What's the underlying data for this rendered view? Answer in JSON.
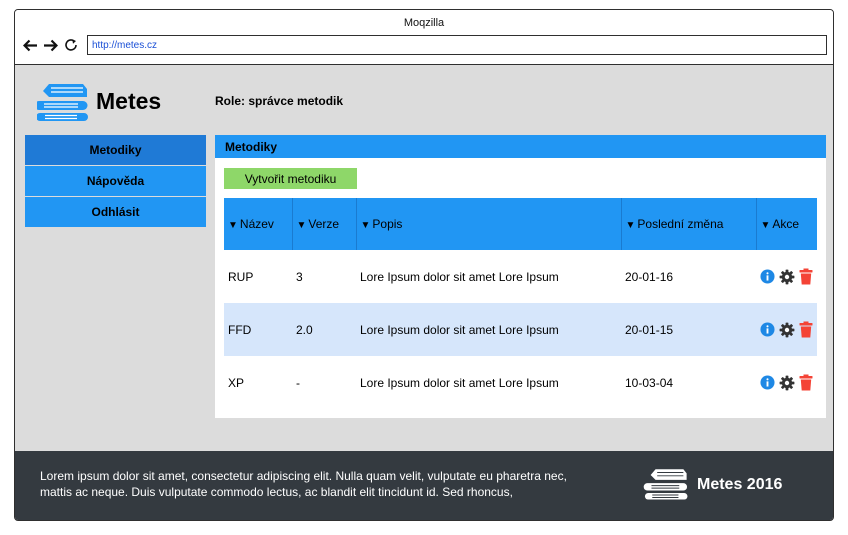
{
  "browser": {
    "title": "Moqzilla",
    "url": "http://metes.cz"
  },
  "app": {
    "name": "Metes",
    "role": "Role: správce metodik"
  },
  "sidebar": {
    "items": [
      {
        "label": "Metodiky"
      },
      {
        "label": "Nápověda"
      },
      {
        "label": "Odhlásit"
      }
    ]
  },
  "panel": {
    "title": "Metodiky",
    "create_label": "Vytvořit metodiku"
  },
  "table": {
    "columns": [
      "Název",
      "Verze",
      "Popis",
      "Poslední změna",
      "Akce"
    ],
    "rows": [
      {
        "name": "RUP",
        "version": "3",
        "description": "Lore Ipsum dolor sit amet Lore Ipsum",
        "changed": "20-01-16"
      },
      {
        "name": "FFD",
        "version": "2.0",
        "description": "Lore Ipsum dolor sit amet Lore Ipsum",
        "changed": "20-01-15"
      },
      {
        "name": "XP",
        "version": "-",
        "description": "Lore Ipsum dolor sit amet Lore Ipsum",
        "changed": "10-03-04"
      }
    ]
  },
  "footer": {
    "text": "Lorem ipsum dolor sit amet, consectetur adipiscing elit. Nulla quam velit, vulputate eu pharetra nec, mattis ac neque. Duis vulputate commodo lectus, ac blandit elit tincidunt id. Sed rhoncus,",
    "brand": "Metes 2016"
  },
  "icons": {
    "nav": [
      "arrow-left-icon",
      "arrow-right-icon",
      "reload-icon"
    ],
    "row_actions": [
      "info-icon",
      "gear-icon",
      "trash-icon"
    ]
  },
  "colors": {
    "accent": "#2196f3",
    "active_nav": "#1f7ad6",
    "create": "#8ed769",
    "row_alt": "#d6e6fb",
    "footer": "#343a40",
    "info": "#1e88e5",
    "delete": "#f44336"
  }
}
